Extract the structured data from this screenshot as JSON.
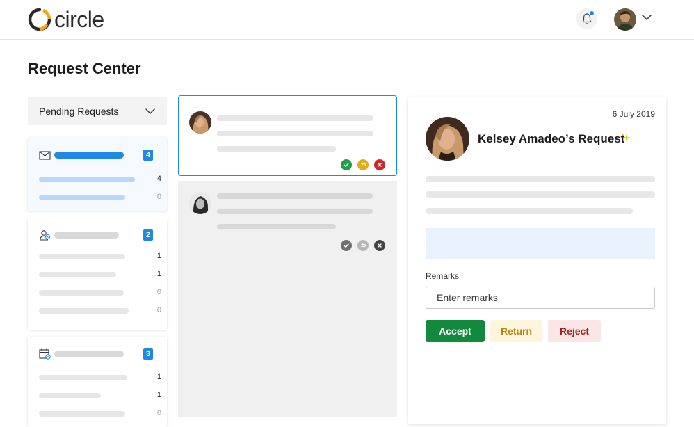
{
  "app": {
    "logo_text": "circle",
    "brand_color": "#f2a515"
  },
  "header": {
    "notification_icon": "bell-icon",
    "notification_dot_color": "#1e88e5"
  },
  "page": {
    "title": "Request Center"
  },
  "filter": {
    "selected": "Pending Requests"
  },
  "categories": [
    {
      "icon": "mail-icon",
      "badge": "4",
      "counts": [
        "4",
        "0"
      ]
    },
    {
      "icon": "user-group-icon",
      "badge": "2",
      "counts": [
        "1",
        "1",
        "0",
        "0"
      ]
    },
    {
      "icon": "calendar-clock-icon",
      "badge": "3",
      "counts": [
        "1",
        "1",
        "0"
      ]
    }
  ],
  "requests": [
    {
      "state": "selected",
      "actions": [
        "accept",
        "return",
        "reject"
      ]
    },
    {
      "state": "inactive",
      "actions": [
        "accept",
        "return",
        "reject"
      ]
    }
  ],
  "detail": {
    "date": "6 July 2019",
    "name": "Kelsey Amadeo’s Request",
    "remarks_label": "Remarks",
    "remarks_placeholder": "Enter remarks",
    "accept_label": "Accept",
    "return_label": "Return",
    "reject_label": "Reject"
  },
  "colors": {
    "accent": "#1e88e5",
    "accept": "#128a3e",
    "return": "#e6ad12",
    "reject": "#d32626"
  }
}
